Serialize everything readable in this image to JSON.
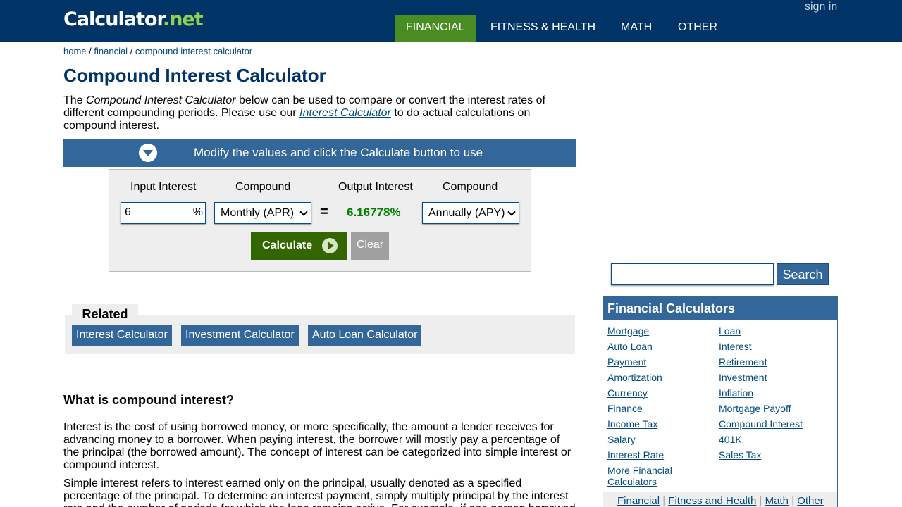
{
  "header": {
    "logo_main": "Calculator",
    "logo_dot": ".",
    "logo_net": "net",
    "signin": "sign in",
    "nav": [
      "FINANCIAL",
      "FITNESS & HEALTH",
      "MATH",
      "OTHER"
    ],
    "nav_active_color": "#4a8c24",
    "bg_color": "#003366"
  },
  "breadcrumb": {
    "items": [
      "home",
      "financial",
      "compound interest calculator"
    ],
    "separator": " / "
  },
  "page_title": "Compound Interest Calculator",
  "intro": {
    "part1": "The ",
    "em1": "Compound Interest Calculator",
    "part2": " below can be used to compare or convert the interest rates of different compounding periods. Please use our ",
    "link": "Interest Calculator",
    "part3": " to do actual calculations on compound interest."
  },
  "modify_bar": {
    "icon": "chevron-down-circle-icon",
    "text": "Modify the values and click the Calculate button to use"
  },
  "calculator": {
    "input_label": "Input Interest",
    "compound_label_1": "Compound",
    "output_label": "Output Interest",
    "compound_label_2": "Compound",
    "input_value": "6",
    "percent": "%",
    "compound_in": "Monthly (APR)",
    "equals": "=",
    "output_value": "6.16778%",
    "compound_out": "Annually (APY)",
    "calculate": "Calculate",
    "clear": "Clear"
  },
  "related": {
    "title": "Related",
    "links": [
      "Interest Calculator",
      "Investment Calculator",
      "Auto Loan Calculator"
    ]
  },
  "article": {
    "heading": "What is compound interest?",
    "p1": "Interest is the cost of using borrowed money, or more specifically, the amount a lender receives for advancing money to a borrower. When paying interest, the borrower will mostly pay a percentage of the principal (the borrowed amount). The concept of interest can be categorized into simple interest or compound interest.",
    "p2": "Simple interest refers to interest earned only on the principal, usually denoted as a specified percentage of the principal. To determine an interest payment, simply multiply principal by the interest rate and the number of periods for which the loan remains active. For example, if one person borrowed"
  },
  "search": {
    "value": "",
    "button": "Search"
  },
  "sidebar": {
    "title": "Financial Calculators",
    "left": [
      "Mortgage",
      "Auto Loan",
      "Payment",
      "Amortization",
      "Currency",
      "Finance",
      "Income Tax",
      "Salary",
      "Interest Rate"
    ],
    "more_line1": "More Financial",
    "more_line2": "Calculators",
    "right": [
      "Loan",
      "Interest",
      "Retirement",
      "Investment",
      "Inflation",
      "Mortgage Payoff",
      "Compound Interest",
      "401K",
      "Sales Tax"
    ],
    "footer": [
      "Financial",
      "Fitness and Health",
      "Math",
      "Other"
    ],
    "footer_sep": "|"
  }
}
